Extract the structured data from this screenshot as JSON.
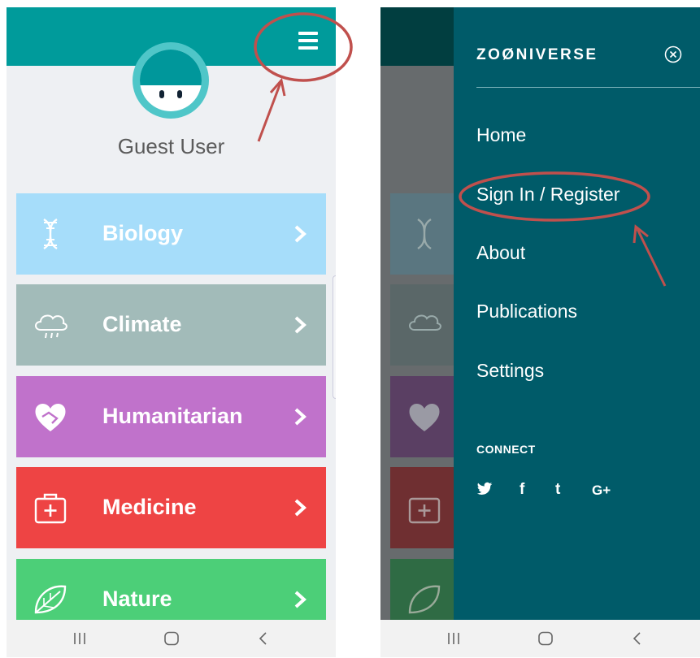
{
  "left_screen": {
    "user": {
      "name": "Guest User"
    },
    "categories": [
      {
        "label": "Biology",
        "color": "#a6ddfa",
        "icon": "dna-icon"
      },
      {
        "label": "Climate",
        "color": "#a2bbb9",
        "icon": "rain-cloud-icon"
      },
      {
        "label": "Humanitarian",
        "color": "#c072cb",
        "icon": "heart-handshake-icon"
      },
      {
        "label": "Medicine",
        "color": "#ee4444",
        "icon": "medical-kit-icon"
      },
      {
        "label": "Nature",
        "color": "#4ccf78",
        "icon": "leaf-icon"
      }
    ],
    "header_color": "#009b9b"
  },
  "right_screen": {
    "drawer": {
      "brand": "ZOØNIVERSE",
      "items": [
        "Home",
        "Sign In / Register",
        "About",
        "Publications",
        "Settings"
      ],
      "connect_heading": "CONNECT",
      "social": [
        "twitter-icon",
        "facebook-icon",
        "tumblr-icon",
        "google-plus-icon"
      ],
      "social_labels": {
        "facebook": "f",
        "tumblr": "t",
        "google_plus": "G+"
      }
    },
    "drawer_color": "#005b69"
  },
  "navigation_icons": [
    "recent-apps-icon",
    "home-icon",
    "back-icon"
  ],
  "annotation_color": "#c0504d"
}
